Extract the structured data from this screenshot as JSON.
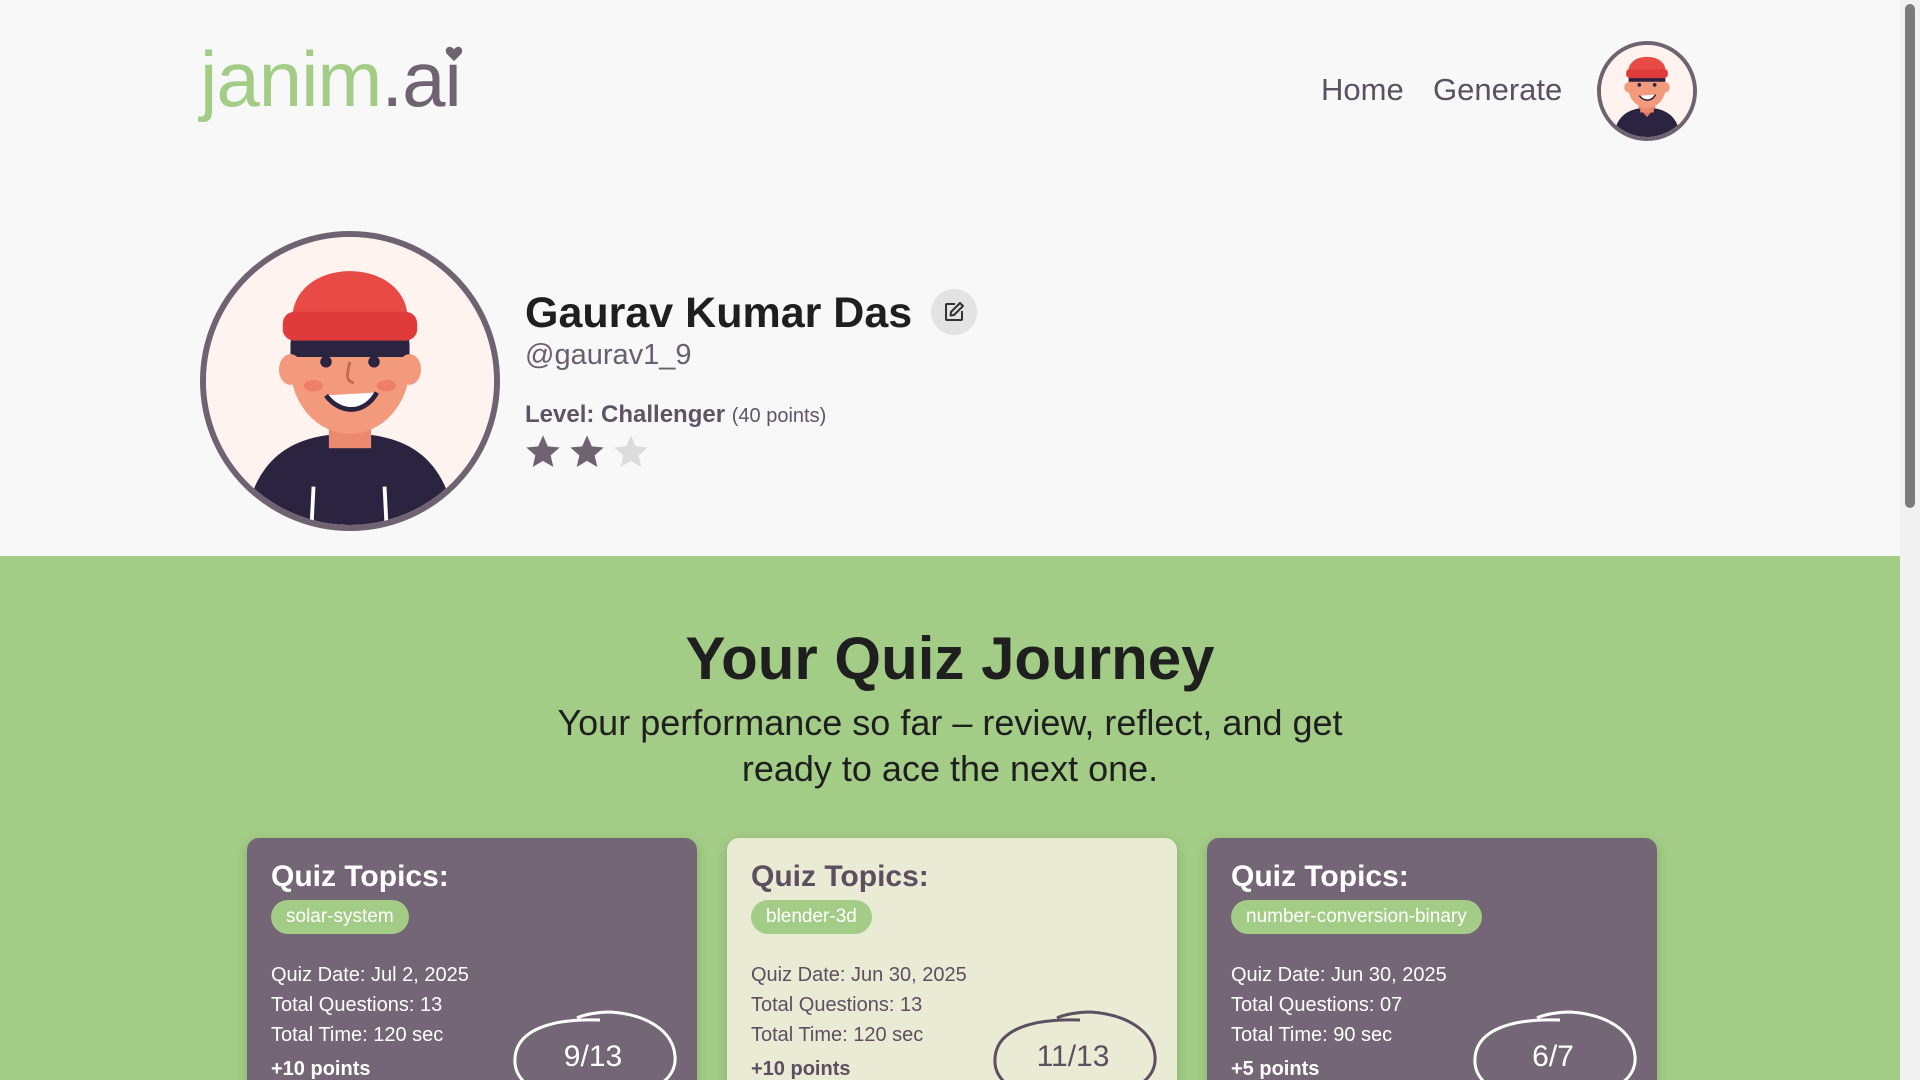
{
  "header": {
    "logo_part1": "janim",
    "logo_part2": ".ai",
    "nav": {
      "home": "Home",
      "generate": "Generate"
    }
  },
  "profile": {
    "name": "Gaurav Kumar Das",
    "handle": "@gaurav1_9",
    "level_label": "Level: Challenger",
    "points_text": "(40 points)",
    "stars_filled": 2,
    "stars_total": 3
  },
  "journey": {
    "title": "Your Quiz Journey",
    "subtitle": "Your performance so far – review, reflect, and get ready to ace the next one."
  },
  "cards": [
    {
      "title": "Quiz Topics:",
      "topic": "solar-system",
      "date": "Quiz Date: Jul 2, 2025",
      "questions": "Total Questions: 13",
      "time": "Total Time: 120 sec",
      "points": "+10 points",
      "score": "9/13"
    },
    {
      "title": "Quiz Topics:",
      "topic": "blender-3d",
      "date": "Quiz Date: Jun 30, 2025",
      "questions": "Total Questions: 13",
      "time": "Total Time: 120 sec",
      "points": "+10 points",
      "score": "11/13"
    },
    {
      "title": "Quiz Topics:",
      "topic": "number-conversion-binary",
      "date": "Quiz Date: Jun 30, 2025",
      "questions": "Total Questions: 07",
      "time": "Total Time: 90 sec",
      "points": "+5 points",
      "score": "6/7"
    }
  ],
  "colors": {
    "brand_green": "#a3cd86",
    "brand_purple": "#6f6372",
    "card_dark": "#746676",
    "card_light": "#e9ebd4"
  },
  "icons": [
    "heart-icon",
    "edit-icon",
    "star-icon"
  ]
}
